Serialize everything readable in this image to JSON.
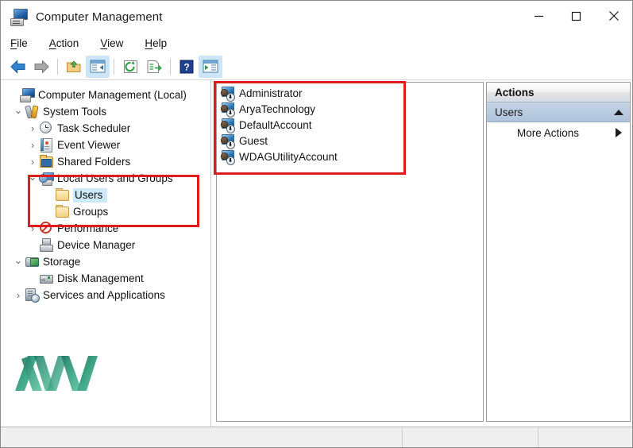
{
  "window": {
    "title": "Computer Management",
    "icon": "computer-management-icon",
    "controls": {
      "minimize": "minimize-icon",
      "maximize": "maximize-icon",
      "close": "close-icon"
    }
  },
  "menubar": {
    "items": [
      {
        "label": "File",
        "accel": "F"
      },
      {
        "label": "Action",
        "accel": "A"
      },
      {
        "label": "View",
        "accel": "V"
      },
      {
        "label": "Help",
        "accel": "H"
      }
    ]
  },
  "toolbar": {
    "buttons": [
      {
        "name": "back-icon",
        "active": false
      },
      {
        "name": "forward-icon",
        "active": false
      },
      {
        "name": "up-folder-icon",
        "active": false
      },
      {
        "name": "show-hide-console-tree-icon",
        "active": true
      },
      {
        "name": "refresh-icon",
        "active": false
      },
      {
        "name": "export-list-icon",
        "active": false
      },
      {
        "name": "help-icon",
        "active": false
      },
      {
        "name": "show-hide-action-pane-icon",
        "active": true
      }
    ]
  },
  "tree": {
    "items": [
      {
        "label": "Computer Management (Local)",
        "indent": 0,
        "twist": "",
        "icon": "computer-icon",
        "selected": false
      },
      {
        "label": "System Tools",
        "indent": 1,
        "twist": "expanded",
        "icon": "system-tools-icon",
        "selected": false
      },
      {
        "label": "Task Scheduler",
        "indent": 2,
        "twist": "collapsed",
        "icon": "task-scheduler-icon",
        "selected": false
      },
      {
        "label": "Event Viewer",
        "indent": 2,
        "twist": "collapsed",
        "icon": "event-viewer-icon",
        "selected": false
      },
      {
        "label": "Shared Folders",
        "indent": 2,
        "twist": "collapsed",
        "icon": "shared-folders-icon",
        "selected": false
      },
      {
        "label": "Local Users and Groups",
        "indent": 2,
        "twist": "expanded",
        "icon": "local-users-and-groups-icon",
        "selected": false
      },
      {
        "label": "Users",
        "indent": 3,
        "twist": "",
        "icon": "folder-icon",
        "selected": true
      },
      {
        "label": "Groups",
        "indent": 3,
        "twist": "",
        "icon": "folder-icon",
        "selected": false
      },
      {
        "label": "Performance",
        "indent": 2,
        "twist": "collapsed",
        "icon": "performance-icon",
        "selected": false
      },
      {
        "label": "Device Manager",
        "indent": 2,
        "twist": "",
        "icon": "device-manager-icon",
        "selected": false
      },
      {
        "label": "Storage",
        "indent": 1,
        "twist": "expanded",
        "icon": "storage-icon",
        "selected": false
      },
      {
        "label": "Disk Management",
        "indent": 2,
        "twist": "",
        "icon": "disk-management-icon",
        "selected": false
      },
      {
        "label": "Services and Applications",
        "indent": 1,
        "twist": "collapsed",
        "icon": "services-and-applications-icon",
        "selected": false
      }
    ]
  },
  "userlist": {
    "items": [
      {
        "name": "Administrator",
        "icon": "user-account-icon"
      },
      {
        "name": "AryaTechnology",
        "icon": "user-account-icon"
      },
      {
        "name": "DefaultAccount",
        "icon": "user-account-icon"
      },
      {
        "name": "Guest",
        "icon": "user-account-icon"
      },
      {
        "name": "WDAGUtilityAccount",
        "icon": "user-account-icon"
      }
    ]
  },
  "actions": {
    "header": "Actions",
    "group": {
      "label": "Users",
      "collapse_icon": "chevron-up-icon"
    },
    "items": [
      {
        "label": "More Actions",
        "submenu_icon": "chevron-right-icon"
      }
    ]
  },
  "statusbar": {
    "segments": [
      "",
      "",
      ""
    ]
  },
  "watermark": {
    "text": "AVA",
    "colors": {
      "dark": "#1f7a63",
      "mid": "#3da184",
      "light": "#62c7a4"
    }
  },
  "annotations": {
    "highlights": [
      {
        "name": "tree-local-users-and-groups-highlight",
        "color": "#e01b1b"
      },
      {
        "name": "users-list-highlight",
        "color": "#e01b1b"
      }
    ]
  },
  "colors": {
    "selection": "#cde8f7",
    "actions_group": "#aec3da",
    "annotation_red": "#e01b1b",
    "window_bg": "#ffffff",
    "statusbar_bg": "#efefef"
  }
}
